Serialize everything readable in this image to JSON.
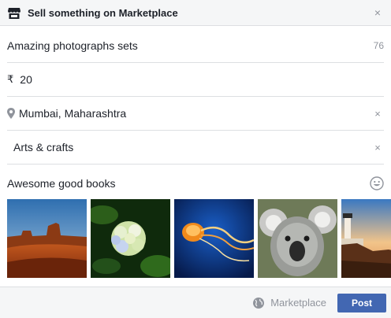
{
  "header": {
    "title": "Sell something on Marketplace",
    "store_icon": "store-icon",
    "close_symbol": "×"
  },
  "form": {
    "title_value": "Amazing photographs sets",
    "title_remaining": "76",
    "currency_symbol": "₹",
    "price_value": "20",
    "location_value": "Mumbai, Maharashtra",
    "category_value": "Arts & crafts",
    "description_value": "Awesome good books",
    "clear_symbol": "×"
  },
  "photos": [
    {
      "name": "photo-desert",
      "subject": "desert mesa"
    },
    {
      "name": "photo-hydrangea",
      "subject": "hydrangea flower"
    },
    {
      "name": "photo-jellyfish",
      "subject": "jellyfish"
    },
    {
      "name": "photo-koala",
      "subject": "koala"
    },
    {
      "name": "photo-lighthouse",
      "subject": "lighthouse"
    }
  ],
  "footer": {
    "audience_label": "Marketplace",
    "post_label": "Post"
  },
  "colors": {
    "accent": "#4267b2",
    "muted": "#90949c",
    "border": "#dddfe2",
    "bar_bg": "#f5f6f7"
  }
}
